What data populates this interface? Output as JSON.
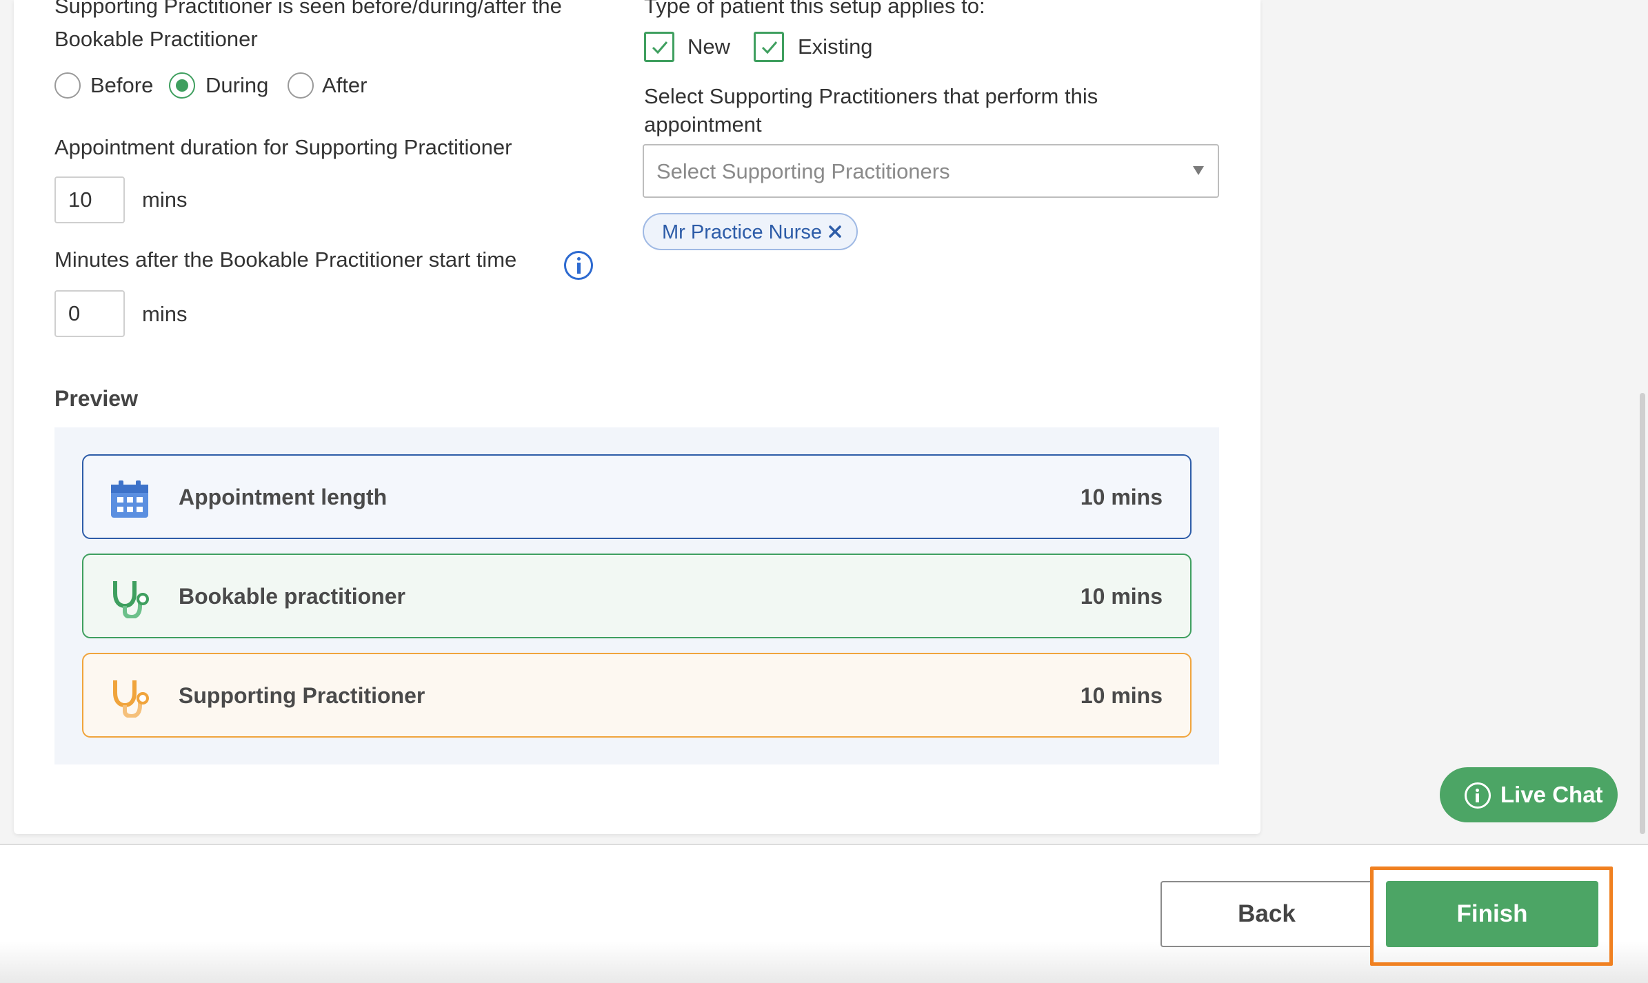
{
  "left": {
    "seen_label_line1": "Supporting Practitioner is seen before/during/after the",
    "seen_label_line2": "Bookable Practitioner",
    "radio_options": [
      "Before",
      "During",
      "After"
    ],
    "radio_selected": "During",
    "duration_label": "Appointment duration for Supporting Practitioner",
    "duration_value": "10",
    "duration_unit": "mins",
    "offset_label": "Minutes after the Bookable Practitioner start time",
    "offset_value": "0",
    "offset_unit": "mins"
  },
  "right": {
    "patient_type_label": "Type of patient this setup applies to:",
    "patient_types": [
      {
        "label": "New",
        "checked": true
      },
      {
        "label": "Existing",
        "checked": true
      }
    ],
    "supporting_label_line1": "Select Supporting Practitioners that perform this",
    "supporting_label_line2": "appointment",
    "select_placeholder": "Select Supporting Practitioners",
    "selected_chips": [
      "Mr Practice Nurse"
    ]
  },
  "preview": {
    "title": "Preview",
    "rows": [
      {
        "label": "Appointment length",
        "value": "10 mins",
        "icon": "calendar-icon",
        "color": "#2d5ca8"
      },
      {
        "label": "Bookable practitioner",
        "value": "10 mins",
        "icon": "stethoscope-icon",
        "color": "#3f9f5f"
      },
      {
        "label": "Supporting Practitioner",
        "value": "10 mins",
        "icon": "stethoscope-icon",
        "color": "#f0a43c"
      }
    ]
  },
  "live_chat": {
    "label": "Live Chat"
  },
  "footer": {
    "back_label": "Back",
    "finish_label": "Finish"
  },
  "colors": {
    "accent_green": "#4ca565",
    "highlight": "#f08020",
    "link_blue": "#2d5ca8"
  }
}
